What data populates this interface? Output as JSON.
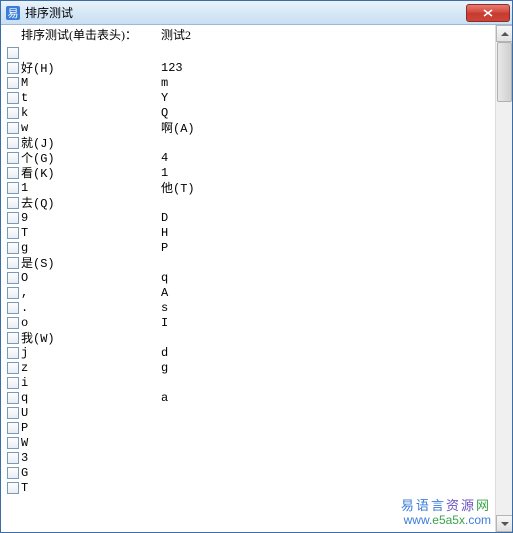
{
  "window": {
    "title": "排序测试"
  },
  "headers": {
    "col1": "排序测试(单击表头)：",
    "col2": "测试2"
  },
  "rows": [
    {
      "c1": "",
      "c2": ""
    },
    {
      "c1": "好(H)",
      "c2": "123"
    },
    {
      "c1": "M",
      "c2": "m"
    },
    {
      "c1": "t",
      "c2": "Y"
    },
    {
      "c1": "k",
      "c2": "Q"
    },
    {
      "c1": "w",
      "c2": "啊(A)"
    },
    {
      "c1": "就(J)",
      "c2": ""
    },
    {
      "c1": "个(G)",
      "c2": "4"
    },
    {
      "c1": "看(K)",
      "c2": "1"
    },
    {
      "c1": "1",
      "c2": "他(T)"
    },
    {
      "c1": "去(Q)",
      "c2": ""
    },
    {
      "c1": "9",
      "c2": "D"
    },
    {
      "c1": "T",
      "c2": "H"
    },
    {
      "c1": "g",
      "c2": "P"
    },
    {
      "c1": "是(S)",
      "c2": ""
    },
    {
      "c1": "O",
      "c2": "q"
    },
    {
      "c1": ",",
      "c2": "A"
    },
    {
      "c1": ".",
      "c2": "s"
    },
    {
      "c1": "o",
      "c2": "I"
    },
    {
      "c1": "我(W)",
      "c2": ""
    },
    {
      "c1": "j",
      "c2": "d"
    },
    {
      "c1": "z",
      "c2": "g"
    },
    {
      "c1": "i",
      "c2": ""
    },
    {
      "c1": "q",
      "c2": "a"
    },
    {
      "c1": "U",
      "c2": ""
    },
    {
      "c1": "P",
      "c2": ""
    },
    {
      "c1": "W",
      "c2": ""
    },
    {
      "c1": "3",
      "c2": ""
    },
    {
      "c1": "G",
      "c2": ""
    },
    {
      "c1": "T",
      "c2": ""
    }
  ],
  "watermark": {
    "line1_chars": [
      "易",
      "语",
      "言",
      "资",
      "源",
      "网"
    ],
    "line2_pre": "www.",
    "line2_mid": "e5a5x",
    "line2_suf": ".com"
  }
}
